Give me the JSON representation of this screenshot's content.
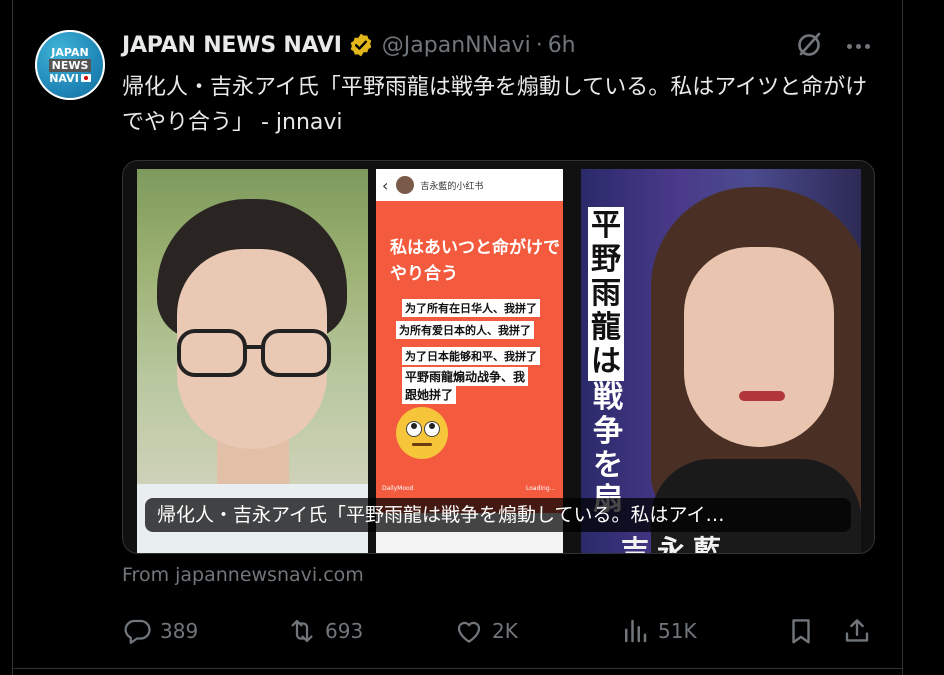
{
  "post": {
    "avatar": {
      "line1": "JAPAN",
      "line2": "NEWS",
      "line3": "NAVI"
    },
    "display_name": "JAPAN NEWS NAVI",
    "handle": "@JapanNNavi",
    "separator": "·",
    "time": "6h",
    "text": "帰化人・吉永アイ氏「平野雨龍は戦争を煽動している。私はアイツと命がけでやり合う」 - jnnavi",
    "media": {
      "caption": "帰化人・吉永アイ氏「平野雨龍は戦争を煽動している。私はアイ…",
      "screenshot": {
        "back": "‹",
        "account": "吉永藍的小红书",
        "title": "私はあいつと命がけでやり合う",
        "lines": [
          "为了所有在日华人、我拼了",
          "为所有爱日本的人、我拼了",
          "为了日本能够和平、我拼了",
          "平野雨龍煽动战争、我",
          "跟她拼了"
        ],
        "footer_left": "DailyMood",
        "footer_right": "Loading..."
      },
      "poster": {
        "vertical_boxed": [
          "平",
          "野",
          "雨",
          "龍",
          "は"
        ],
        "vertical_plain": [
          "戦",
          "争",
          "を",
          "扇"
        ],
        "bottom_text": "吉永藍"
      }
    },
    "source": "From japannewsnavi.com",
    "actions": {
      "replies": "389",
      "reposts": "693",
      "likes": "2K",
      "views": "51K"
    }
  },
  "colors": {
    "background": "#000000",
    "text": "#e7e9ea",
    "muted": "#71767b",
    "verified": "#e2b719",
    "border": "#2f3336"
  },
  "icons": [
    "verified-badge-icon",
    "grok-icon",
    "more-icon",
    "reply-icon",
    "repost-icon",
    "like-icon",
    "views-icon",
    "bookmark-icon",
    "share-icon"
  ]
}
